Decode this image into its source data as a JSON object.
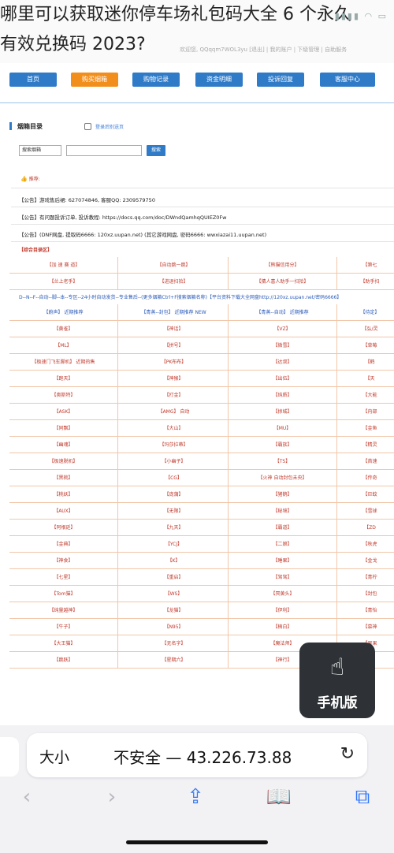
{
  "caption": {
    "line1": "哪里可以获取迷你停车场礼包码大全 6 个永久",
    "line2": "有效兑换码 2023?"
  },
  "site_header": {
    "user_info": "欢迎您, QQqqm7WOL3yu  [退出]  |  我的账户  |  下级管理  |  自助服务"
  },
  "status_icons": "▮▮▮▮ ◠ ▭",
  "nav": {
    "items": [
      "首页",
      "购买烟箱",
      "购物记录",
      "资金明细",
      "投诉回复",
      "客服中心"
    ],
    "active_index": 1
  },
  "catalog": {
    "title": "烟箱目录",
    "checkbox_label": "登录后别送页",
    "search_select": "搜索烟箱",
    "search_button": "搜索"
  },
  "recommend_label": "推荐:",
  "notices": [
    "【公告】游戏售后裙: 627074846, 客服QQ: 2309579750",
    "【公告】有问题投诉订单, 投诉教程: https://docs.qq.com/doc/DWndQamhqQUIEZ0Fw",
    "【公告】(DNF网盘, 提取码6666: 120xz.uupan.net) (其它游戏网盘, 密码6666: wwxiazai11.uupan.net)"
  ],
  "section_head": "【综合目录区】",
  "banner": "D--N--F--自动--脚--本--专区--24小时自动发货--专业售后--(更多烟箱Ctrl+F搜索烟箱名称)【平台资料下载大全网盘http://120xz.uupan.net/密码6666】",
  "table_rows": [
    [
      "【加 速 赛 道】",
      "【自动跳一跳】",
      "【熊猫信用分】",
      "【第七"
    ],
    [
      "【兰上老手】",
      "【进退扫拾】",
      "【猜人喜人助手一扫拾】",
      "【助手扫"
    ],
    [
      "【蔚声】  近期推荐",
      "【青蒸--封包】 近期推荐 NEW",
      "【青蒸--自动】  近期推荐",
      "【待定】"
    ],
    [
      "【黄雀】",
      "【神话】",
      "【VZ】",
      "【弘/灵"
    ],
    [
      "【ML】",
      "【拼号】",
      "【微雪】",
      "【草莓"
    ],
    [
      "【极速门飞车脚机】 近期热售",
      "【PK布布】",
      "【达叔】",
      "【鹤"
    ],
    [
      "【跑天】",
      "【神猴】",
      "【出伍】",
      "【天"
    ],
    [
      "【奥斯特】",
      "【打金】",
      "【纯质】",
      "【大能"
    ],
    [
      "【ASK】",
      "【AMG】 自动",
      "【掠城】",
      "【内部"
    ],
    [
      "【同飘】",
      "【大山】",
      "【MU】",
      "【金鱼"
    ],
    [
      "【幽魂】",
      "【玛莎拉蒂】",
      "【霸族】",
      "【精灵"
    ],
    [
      "【极速脱机】",
      "【小幽子】",
      "【TS】",
      "【首速"
    ],
    [
      "【黑桃】",
      "【CG】",
      "【火神 自动封包未央】",
      "【传奇"
    ],
    [
      "【桃妖】",
      "【庞蒲】",
      "【猪鹅】",
      "【巨蚊"
    ],
    [
      "【AUX】",
      "【无限】",
      "【秘境】",
      "【雪球"
    ],
    [
      "【阿根廷】",
      "【九天】",
      "【霸道】",
      "【ZD"
    ],
    [
      "【金典】",
      "【YCJ】",
      "【二娘】",
      "【秋虎"
    ],
    [
      "【神食】",
      "【K】",
      "【睡果】",
      "【金戈"
    ],
    [
      "【七星】",
      "【重启】",
      "【驾驾】",
      "【青柠"
    ],
    [
      "【Tom猫】",
      "【WS】",
      "【冥黄头】",
      "【封包"
    ],
    [
      "【纯量越神】",
      "【龙猫】",
      "【伊利】",
      "【青怡"
    ],
    [
      "【牛子】",
      "【N95】",
      "【楠白】",
      "【慕神"
    ],
    [
      "【大王猫】",
      "【无名字】",
      "【魔法师】",
      "【果果"
    ],
    [
      "【跳跃】",
      "【星期六】",
      "【神行】",
      "【蛋"
    ]
  ],
  "floating_button": {
    "label": "手机版"
  },
  "browser": {
    "text_size": "大小",
    "address": "不安全 — 43.226.73.88",
    "reload_icon": "↻",
    "toolbar": [
      "‹",
      "›",
      "⇪",
      "📖",
      "⧉"
    ]
  }
}
